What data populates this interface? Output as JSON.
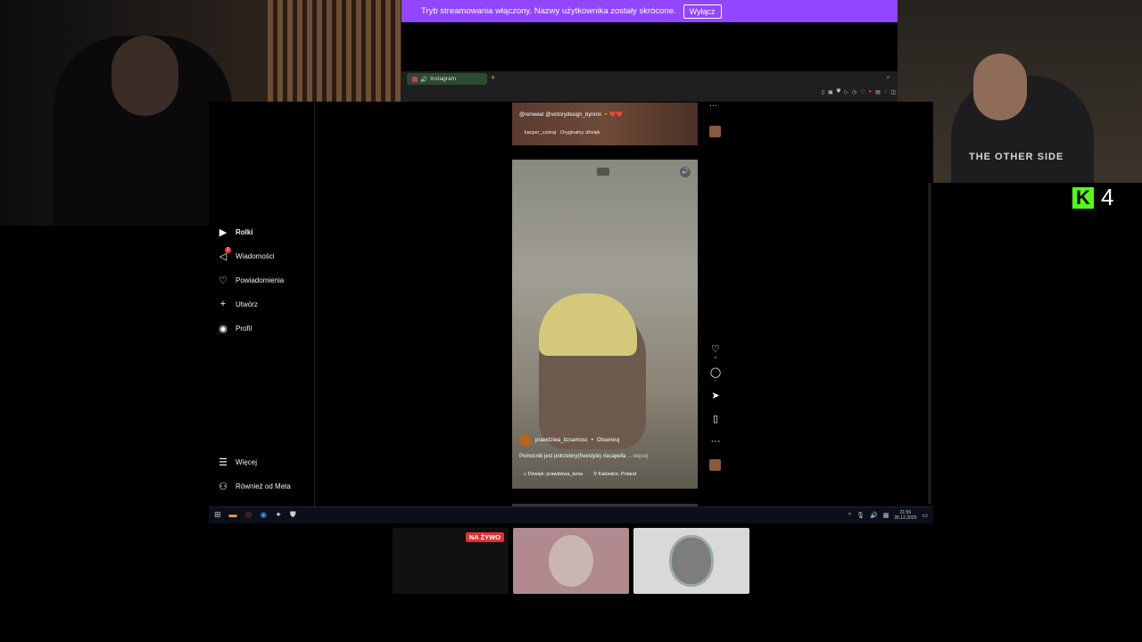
{
  "banner": {
    "text": "Tryb streamowania włączony. Nazwy użytkownika zostały skrócone.",
    "button": "Wyłącz"
  },
  "browser": {
    "tab_title": "Instagram",
    "new_tab": "+"
  },
  "sidebar": {
    "items": [
      {
        "label": "Rolki",
        "icon": "reels-icon"
      },
      {
        "label": "Wiadomości",
        "icon": "messages-icon",
        "badge": "1"
      },
      {
        "label": "Powiadomienia",
        "icon": "heart-icon"
      },
      {
        "label": "Utwórz",
        "icon": "plus-icon"
      },
      {
        "label": "Profil",
        "icon": "profile-avatar-icon"
      }
    ],
    "bottom": [
      {
        "label": "Więcej",
        "icon": "menu-icon"
      },
      {
        "label": "Również od Meta",
        "icon": "meta-icon"
      }
    ]
  },
  "prev_reel": {
    "caption": "@renwear @victorydesign_byrenn 🔸❤️❤️",
    "audio": "kacper_czekaj · Oryginalny dźwięk"
  },
  "reel": {
    "author": "prawdziwa_bzsamosc",
    "follow": "Obserwuj",
    "caption": "Pomocnik jest potrzebny(freestyle) #acapella",
    "more": "... więcej",
    "audio": "Dźwięk: prawdziwa_bzsa",
    "location": "Katowice, Poland"
  },
  "taskbar": {
    "time": "21:56",
    "date": "26.12.2025"
  },
  "overlay": {
    "kick_count": "4",
    "live_badge": "NA ŻYWO",
    "shirt_text": "THE OTHER SIDE"
  },
  "colors": {
    "banner": "#9146ff",
    "kick": "#53fc18",
    "live": "#e53030"
  }
}
